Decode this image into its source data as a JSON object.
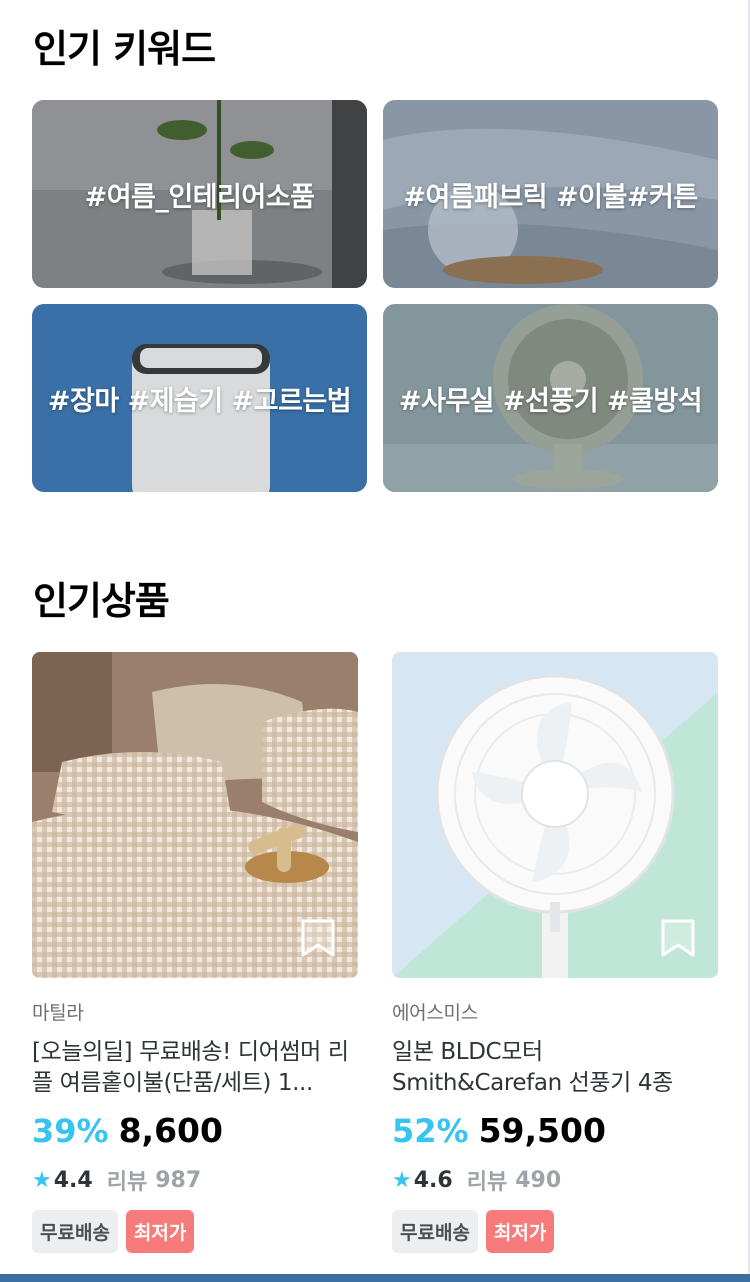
{
  "popular_keywords": {
    "title": "인기 키워드",
    "items": [
      {
        "label": "#여름_인테리어소품"
      },
      {
        "label": "#여름패브릭 #이불#커튼"
      },
      {
        "label": "#장마 #제습기 #고르는법"
      },
      {
        "label": "#사무실 #선풍기 #쿨방석"
      }
    ]
  },
  "popular_products": {
    "title": "인기상품",
    "items": [
      {
        "brand": "마틸라",
        "name": "[오늘의딜] 무료배송! 디어썸머 리플 여름홑이불(단품/세트) 1...",
        "discount": "39%",
        "price": "8,600",
        "rating": "4.4",
        "review_label": "리뷰",
        "review_count": "987",
        "badges": [
          "무료배송",
          "최저가"
        ]
      },
      {
        "brand": "에어스미스",
        "name": "일본 BLDC모터 Smith&Carefan 선풍기 4종",
        "discount": "52%",
        "price": "59,500",
        "rating": "4.6",
        "review_label": "리뷰",
        "review_count": "490",
        "badges": [
          "무료배송",
          "최저가"
        ]
      }
    ]
  },
  "colors": {
    "accent": "#35c5f0",
    "badge_red": "#f77b7b",
    "badge_gray": "#eceef0"
  }
}
